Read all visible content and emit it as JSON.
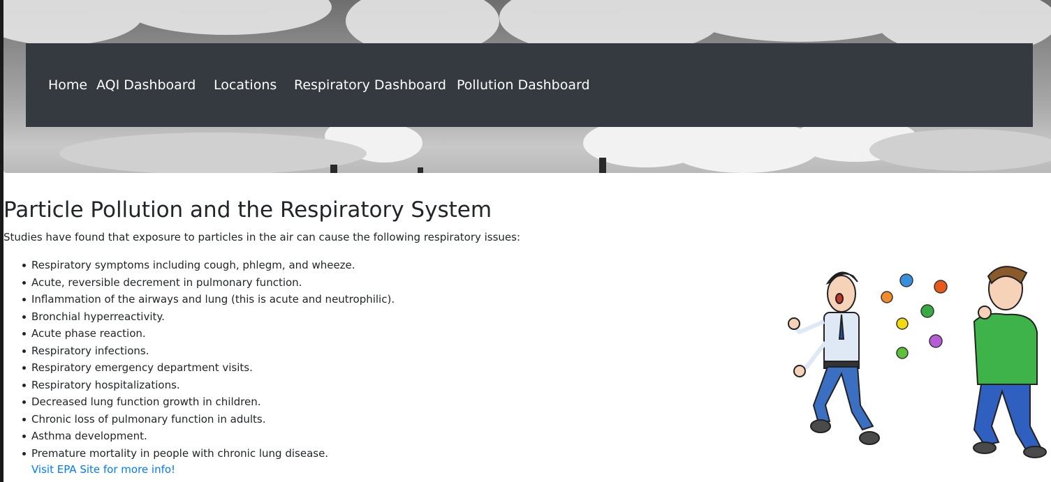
{
  "nav": {
    "items": [
      {
        "label": "Home"
      },
      {
        "label": "AQI Dashboard"
      },
      {
        "label": "Locations"
      },
      {
        "label": "Respiratory Dashboard"
      },
      {
        "label": "Pollution Dashboard"
      }
    ]
  },
  "main": {
    "title": "Particle Pollution and the Respiratory System",
    "intro": "Studies have found that exposure to particles in the air can cause the following respiratory issues:",
    "issues": [
      "Respiratory symptoms including cough, phlegm, and wheeze.",
      "Acute, reversible decrement in pulmonary function.",
      "Inflammation of the airways and lung (this is acute and neutrophilic).",
      "Bronchial hyperreactivity.",
      "Acute phase reaction.",
      "Respiratory infections.",
      "Respiratory emergency department visits.",
      "Respiratory hospitalizations.",
      "Decreased lung function growth in children.",
      "Chronic loss of pulmonary function in adults.",
      "Asthma development.",
      "Premature mortality in people with chronic lung disease."
    ],
    "link_label": "Visit EPA Site for more info!"
  },
  "colors": {
    "navbar_bg": "#343a40",
    "link": "#007bff",
    "text": "#212529"
  },
  "icons": {
    "hero": "smokestack-pollution-image",
    "illustration": "coughing-germs-illustration"
  }
}
